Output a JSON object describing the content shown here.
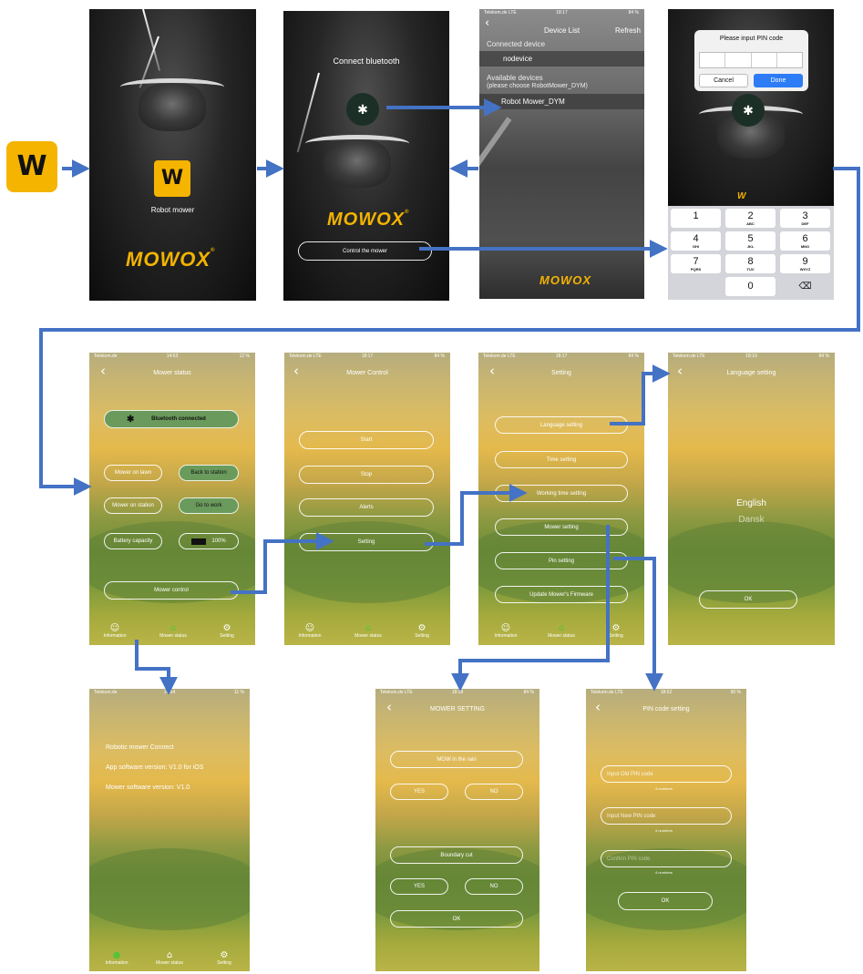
{
  "app_icon": {
    "letter": "W"
  },
  "splash": {
    "label": "Robot mower",
    "icon_letter": "W",
    "logo": "MOWOX",
    "reg": "®"
  },
  "connect": {
    "title": "Connect bluetooth",
    "bt_symbol": "✱",
    "logo": "MOWOX",
    "reg": "®",
    "control_button": "Control the mower"
  },
  "devices": {
    "status_carrier": "Telekom.de  LTE",
    "status_time": "18:17",
    "status_battery": "84 %",
    "title": "Device List",
    "refresh": "Refresh",
    "connected_header": "Connected device",
    "connected_item": "nodevice",
    "available_header": "Available devices",
    "available_hint": "(please choose RobotMower_DYM)",
    "available_item": "Robot Mower_DYM",
    "logo": "MOWOX"
  },
  "pin": {
    "dialog_title": "Please input PIN code",
    "cancel": "Cancel",
    "done": "Done",
    "bt_symbol": "✱",
    "keys": [
      {
        "d": "1",
        "l": ""
      },
      {
        "d": "2",
        "l": "ABC"
      },
      {
        "d": "3",
        "l": "DEF"
      },
      {
        "d": "4",
        "l": "GHI"
      },
      {
        "d": "5",
        "l": "JKL"
      },
      {
        "d": "6",
        "l": "MNO"
      },
      {
        "d": "7",
        "l": "PQRS"
      },
      {
        "d": "8",
        "l": "TUV"
      },
      {
        "d": "9",
        "l": "WXYZ"
      },
      {
        "d": "0",
        "l": ""
      }
    ],
    "backspace": "⌫"
  },
  "status": {
    "carrier": "Telekom.de",
    "time": "14:53",
    "battery": "12 %",
    "title": "Mower status",
    "bt_symbol": "✱",
    "bt_connected": "Bluetooth connected",
    "on_lawn": "Mower on lawn",
    "back_to_station": "Back to station",
    "on_station": "Mower on station",
    "go_to_work": "Go to work",
    "battery_capacity": "Battery capacity",
    "battery_value": "100%",
    "mower_control": "Mower control"
  },
  "control": {
    "carrier": "Telekom.de  LTE",
    "time": "18:17",
    "battery": "84 %",
    "title": "Mower Control",
    "start": "Start",
    "stop": "Stop",
    "alerts": "Alerts",
    "setting": "Setting"
  },
  "setting": {
    "carrier": "Telekom.de  LTE",
    "time": "18:17",
    "battery": "84 %",
    "title": "Setting",
    "items": [
      "Language setting",
      "Time setting",
      "Working time setting",
      "Mower setting",
      "Pin setting",
      "Update Mower's Firmware"
    ]
  },
  "language": {
    "carrier": "Telekom.de  LTE",
    "time": "18:19",
    "battery": "84 %",
    "title": "Language setting",
    "english": "English",
    "dansk": "Dansk",
    "ok": "OK"
  },
  "info": {
    "carrier": "Telekom.de",
    "time": "14:54",
    "battery": "11 %",
    "line1": "Robotic mower Connect",
    "line2": "App software version: V1.0 for iOS",
    "line3": "Mower software version: V1.0"
  },
  "mowset": {
    "carrier": "Telekom.de  LTE",
    "time": "18:18",
    "battery": "84 %",
    "title": "MOWER SETTING",
    "rain": "MOW in the rain",
    "yes": "YES",
    "no": "NO",
    "boundary": "Boundary cut",
    "ok": "OK"
  },
  "pinset": {
    "carrier": "Telekom.de  LTE",
    "time": "18:52",
    "battery": "90 %",
    "title": "PIN code setting",
    "old_placeholder": "Input Old PIN code",
    "new_placeholder": "Input New PIN code",
    "confirm_placeholder": "Confirm PIN code",
    "hint": "4 numbers",
    "ok": "OK"
  },
  "tabs": {
    "information": "Information",
    "mower_status": "Mower status",
    "setting": "Setting"
  },
  "colors": {
    "arrow": "#4472c4",
    "brand_yellow": "#f5b400",
    "active_tab": "#59c23a"
  }
}
